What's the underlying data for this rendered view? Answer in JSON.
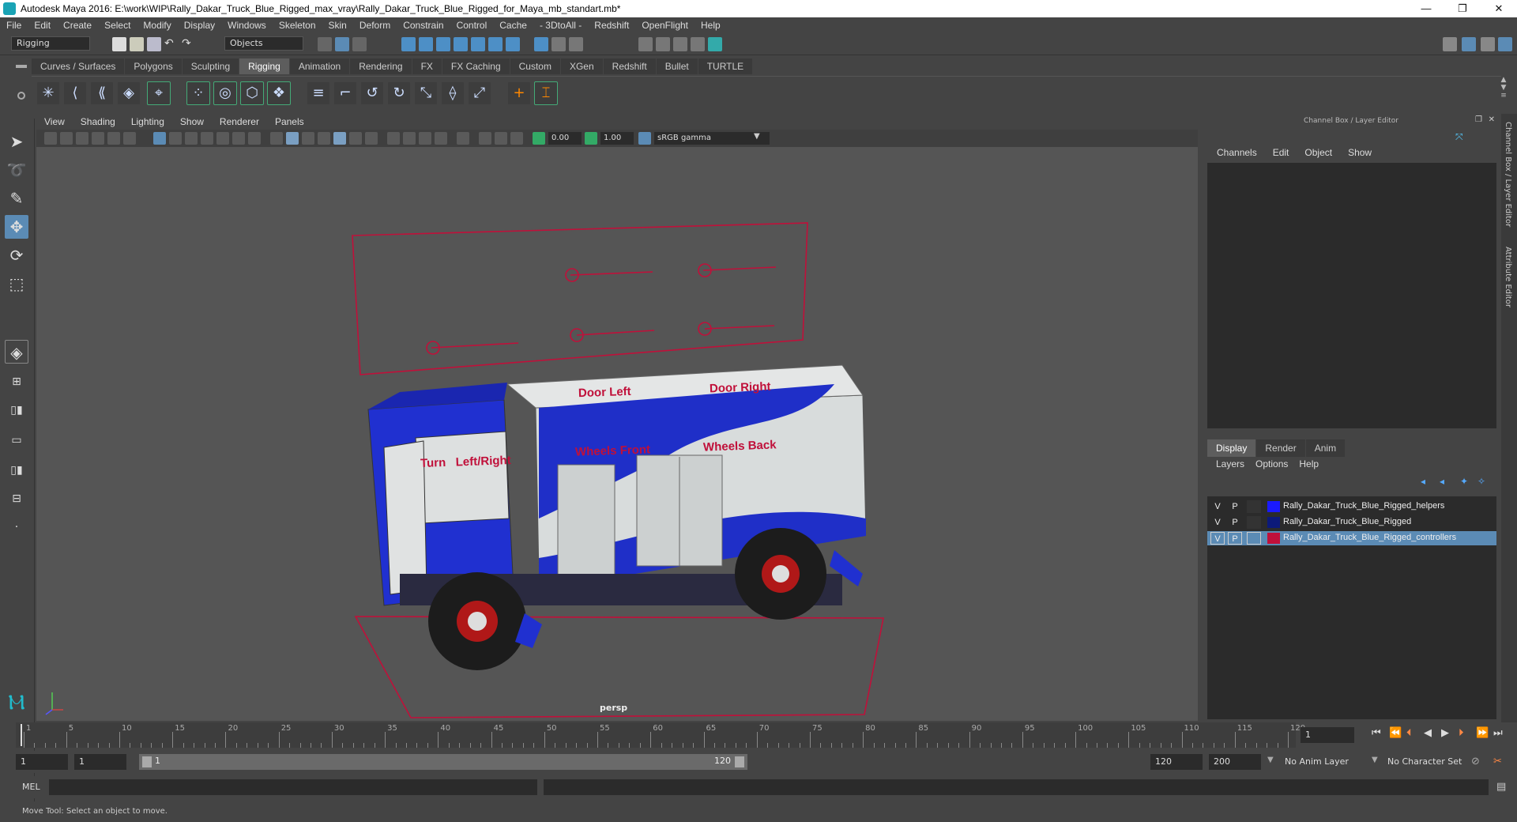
{
  "window": {
    "title": "Autodesk Maya 2016: E:\\work\\WIP\\Rally_Dakar_Truck_Blue_Rigged_max_vray\\Rally_Dakar_Truck_Blue_Rigged_for_Maya_mb_standart.mb*",
    "minimize": "—",
    "restore": "❐",
    "close": "✕"
  },
  "menubar": [
    "File",
    "Edit",
    "Create",
    "Select",
    "Modify",
    "Display",
    "Windows",
    "Skeleton",
    "Skin",
    "Deform",
    "Constrain",
    "Control",
    "Cache",
    "- 3DtoAll -",
    "Redshift",
    "OpenFlight",
    "Help"
  ],
  "status": {
    "mode": "Rigging",
    "selection_mask": "Objects"
  },
  "shelf_tabs": [
    "Curves / Surfaces",
    "Polygons",
    "Sculpting",
    "Rigging",
    "Animation",
    "Rendering",
    "FX",
    "FX Caching",
    "Custom",
    "XGen",
    "Redshift",
    "Bullet",
    "TURTLE"
  ],
  "shelf_active": "Rigging",
  "viewport": {
    "menu": [
      "View",
      "Shading",
      "Lighting",
      "Show",
      "Renderer",
      "Panels"
    ],
    "exposure": "0.00",
    "gamma": "1.00",
    "colorspace": "sRGB gamma",
    "camera": "persp",
    "controls": {
      "door_left": "Door Left",
      "door_right": "Door Right",
      "turn": "Turn   Left/Right",
      "wheels_front": "Wheels Front",
      "wheels_back": "Wheels Back"
    }
  },
  "channel_box": {
    "title": "Channel Box / Layer Editor",
    "menu": [
      "Channels",
      "Edit",
      "Object",
      "Show"
    ]
  },
  "layer_editor": {
    "tabs": [
      "Display",
      "Render",
      "Anim"
    ],
    "active_tab": "Display",
    "menu": [
      "Layers",
      "Options",
      "Help"
    ],
    "layers": [
      {
        "v": "V",
        "p": "P",
        "color": "#1a1aff",
        "name": "Rally_Dakar_Truck_Blue_Rigged_helpers",
        "selected": false
      },
      {
        "v": "V",
        "p": "P",
        "color": "#0c1a7a",
        "name": "Rally_Dakar_Truck_Blue_Rigged",
        "selected": false
      },
      {
        "v": "V",
        "p": "P",
        "color": "#c0103a",
        "name": "Rally_Dakar_Truck_Blue_Rigged_controllers",
        "selected": true
      }
    ]
  },
  "side_tabs": [
    "Channel Box / Layer Editor",
    "Attribute Editor"
  ],
  "timeline": {
    "labels": [
      "1",
      "5",
      "10",
      "15",
      "20",
      "25",
      "30",
      "35",
      "40",
      "45",
      "50",
      "55",
      "60",
      "65",
      "70",
      "75",
      "80",
      "85",
      "90",
      "95",
      "100",
      "105",
      "110",
      "115",
      "120"
    ],
    "current_frame": "1"
  },
  "range": {
    "start": "1",
    "playback_start": "1",
    "slider_start": "1",
    "slider_end": "120",
    "playback_end": "120",
    "end": "200",
    "anim_layer": "No Anim Layer",
    "char_set": "No Character Set"
  },
  "cmd": {
    "label": "MEL"
  },
  "help_line": "Move Tool: Select an object to move."
}
